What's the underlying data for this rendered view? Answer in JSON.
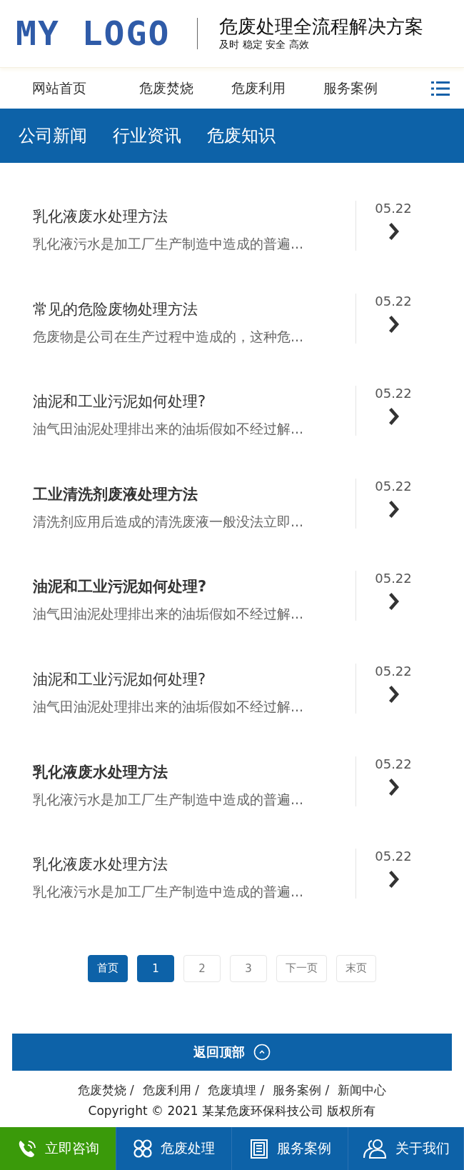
{
  "header": {
    "logo": "MY LOGO",
    "title": "危废处理全流程解决方案",
    "slogan": "及时 稳定 安全 高效"
  },
  "nav": {
    "items": [
      "网站首页",
      "危废焚烧",
      "危废利用",
      "服务案例"
    ]
  },
  "categories": [
    "公司新闻",
    "行业资讯",
    "危废知识"
  ],
  "articles": [
    {
      "title": "乳化液废水处理方法",
      "summary": "乳化液污水是加工厂生产制造中造成的普遍...",
      "date": "05.22",
      "emphasized": false
    },
    {
      "title": "常见的危险废物处理方法",
      "summary": "危废物是公司在生产过程中造成的，这种危...",
      "date": "05.22",
      "emphasized": false
    },
    {
      "title": "油泥和工业污泥如何处理?",
      "summary": "油气田油泥处理排出来的油垢假如不经过解...",
      "date": "05.22",
      "emphasized": false
    },
    {
      "title": "工业清洗剂废液处理方法",
      "summary": "清洗剂应用后造成的清洗废液一般没法立即...",
      "date": "05.22",
      "emphasized": true
    },
    {
      "title": "油泥和工业污泥如何处理?",
      "summary": "油气田油泥处理排出来的油垢假如不经过解...",
      "date": "05.22",
      "emphasized": true
    },
    {
      "title": "油泥和工业污泥如何处理?",
      "summary": "油气田油泥处理排出来的油垢假如不经过解...",
      "date": "05.22",
      "emphasized": false
    },
    {
      "title": "乳化液废水处理方法",
      "summary": "乳化液污水是加工厂生产制造中造成的普遍...",
      "date": "05.22",
      "emphasized": true
    },
    {
      "title": "乳化液废水处理方法",
      "summary": "乳化液污水是加工厂生产制造中造成的普遍...",
      "date": "05.22",
      "emphasized": false
    }
  ],
  "pagination": [
    {
      "label": "首页",
      "selected": true
    },
    {
      "label": "1",
      "selected": true
    },
    {
      "label": "2",
      "selected": false
    },
    {
      "label": "3",
      "selected": false
    },
    {
      "label": "下一页",
      "selected": false
    },
    {
      "label": "末页",
      "selected": false
    }
  ],
  "back_to_top": "返回顶部",
  "footer": {
    "links": [
      "危废焚烧 /",
      "危废利用 /",
      "危废填埋 /",
      "服务案例 /",
      "新闻中心"
    ],
    "copyright": "Copyright © 2021 某某危废环保科技公司 版权所有"
  },
  "bottom_bar": [
    {
      "label": "立即咨询",
      "color": "#3a9a0a"
    },
    {
      "label": "危废处理",
      "color": "#0d62a8"
    },
    {
      "label": "服务案例",
      "color": "#0d62a8"
    },
    {
      "label": "关于我们",
      "color": "#0d62a8"
    }
  ]
}
